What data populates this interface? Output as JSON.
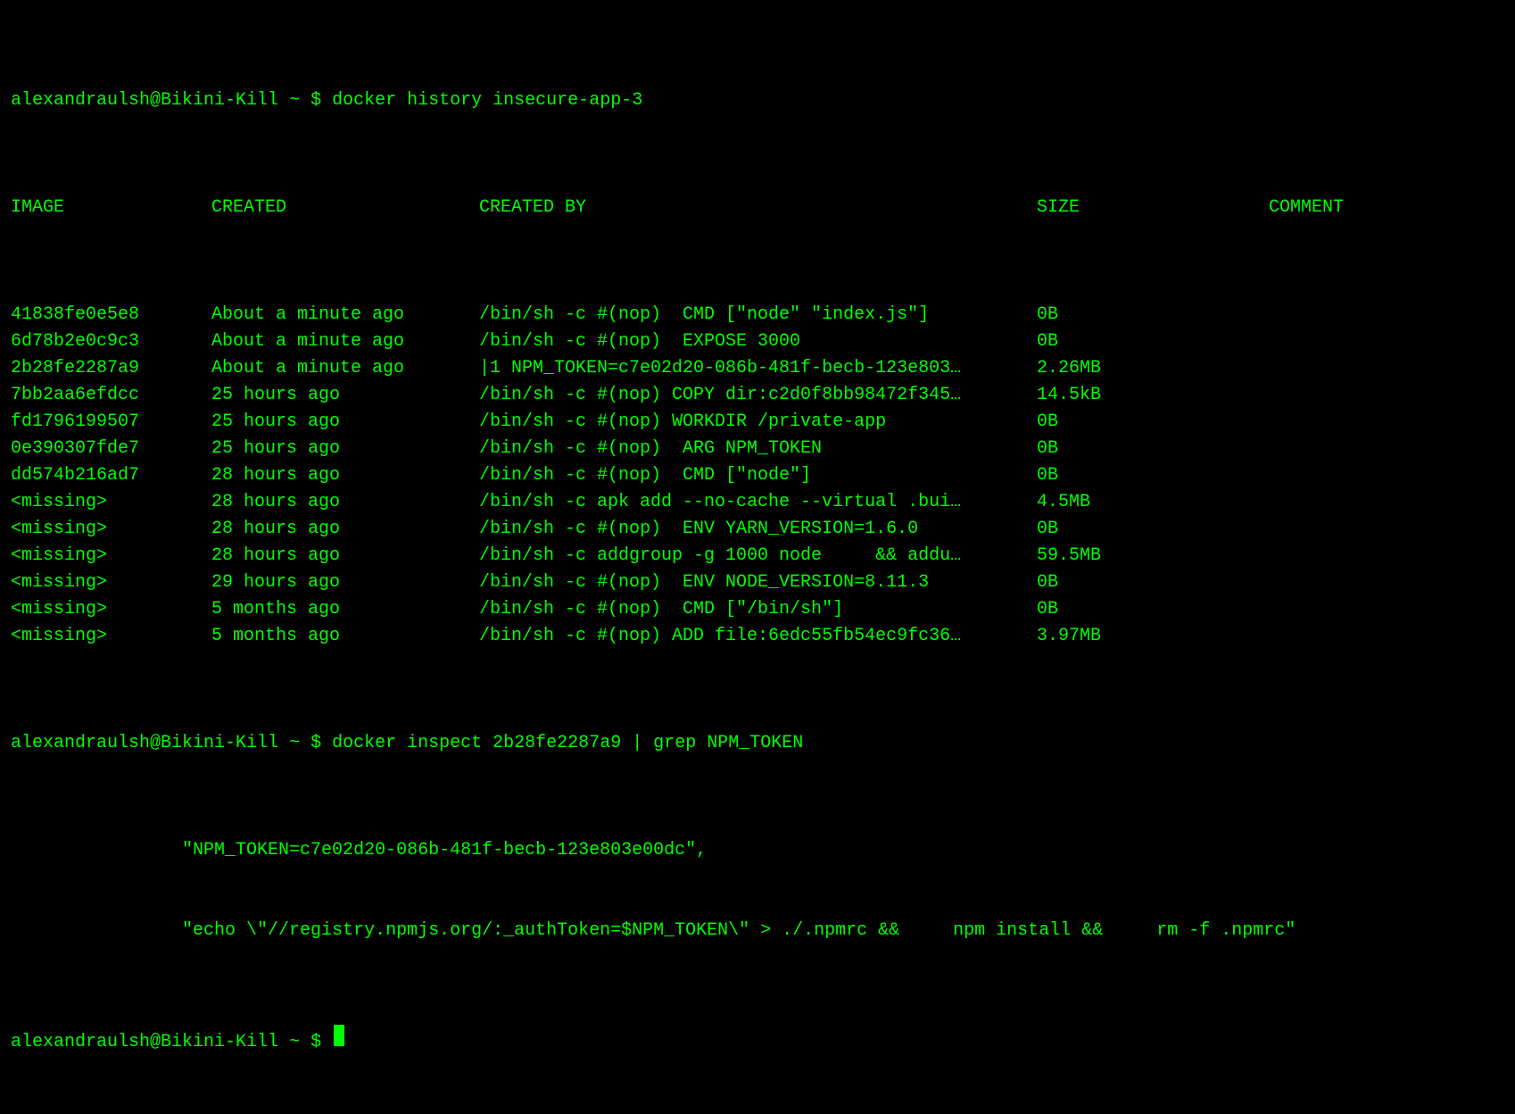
{
  "prompt": {
    "user_host": "alexandraulsh@Bikini-Kill",
    "path": "~",
    "sep": "$"
  },
  "command1": "docker history insecure-app-3",
  "headers": {
    "image": "IMAGE",
    "created": "CREATED",
    "created_by": "CREATED BY",
    "size": "SIZE",
    "comment": "COMMENT"
  },
  "rows": [
    {
      "image": "41838fe0e5e8",
      "created": "About a minute ago",
      "created_by": "/bin/sh -c #(nop)  CMD [\"node\" \"index.js\"]",
      "size": "0B",
      "comment": ""
    },
    {
      "image": "6d78b2e0c9c3",
      "created": "About a minute ago",
      "created_by": "/bin/sh -c #(nop)  EXPOSE 3000",
      "size": "0B",
      "comment": ""
    },
    {
      "image": "2b28fe2287a9",
      "created": "About a minute ago",
      "created_by": "|1 NPM_TOKEN=c7e02d20-086b-481f-becb-123e803…",
      "size": "2.26MB",
      "comment": ""
    },
    {
      "image": "7bb2aa6efdcc",
      "created": "25 hours ago",
      "created_by": "/bin/sh -c #(nop) COPY dir:c2d0f8bb98472f345…",
      "size": "14.5kB",
      "comment": ""
    },
    {
      "image": "fd1796199507",
      "created": "25 hours ago",
      "created_by": "/bin/sh -c #(nop) WORKDIR /private-app",
      "size": "0B",
      "comment": ""
    },
    {
      "image": "0e390307fde7",
      "created": "25 hours ago",
      "created_by": "/bin/sh -c #(nop)  ARG NPM_TOKEN",
      "size": "0B",
      "comment": ""
    },
    {
      "image": "dd574b216ad7",
      "created": "28 hours ago",
      "created_by": "/bin/sh -c #(nop)  CMD [\"node\"]",
      "size": "0B",
      "comment": ""
    },
    {
      "image": "<missing>",
      "created": "28 hours ago",
      "created_by": "/bin/sh -c apk add --no-cache --virtual .bui…",
      "size": "4.5MB",
      "comment": ""
    },
    {
      "image": "<missing>",
      "created": "28 hours ago",
      "created_by": "/bin/sh -c #(nop)  ENV YARN_VERSION=1.6.0",
      "size": "0B",
      "comment": ""
    },
    {
      "image": "<missing>",
      "created": "28 hours ago",
      "created_by": "/bin/sh -c addgroup -g 1000 node     && addu…",
      "size": "59.5MB",
      "comment": ""
    },
    {
      "image": "<missing>",
      "created": "29 hours ago",
      "created_by": "/bin/sh -c #(nop)  ENV NODE_VERSION=8.11.3",
      "size": "0B",
      "comment": ""
    },
    {
      "image": "<missing>",
      "created": "5 months ago",
      "created_by": "/bin/sh -c #(nop)  CMD [\"/bin/sh\"]",
      "size": "0B",
      "comment": ""
    },
    {
      "image": "<missing>",
      "created": "5 months ago",
      "created_by": "/bin/sh -c #(nop) ADD file:6edc55fb54ec9fc36…",
      "size": "3.97MB",
      "comment": ""
    }
  ],
  "command2": "docker inspect 2b28fe2287a9 | grep NPM_TOKEN",
  "output2_line1": "                \"NPM_TOKEN=c7e02d20-086b-481f-becb-123e803e00dc\",",
  "output2_line2": "                \"echo \\\"//registry.npmjs.org/:_authToken=$NPM_TOKEN\\\" > ./.npmrc &&     npm install &&     rm -f .npmrc\""
}
